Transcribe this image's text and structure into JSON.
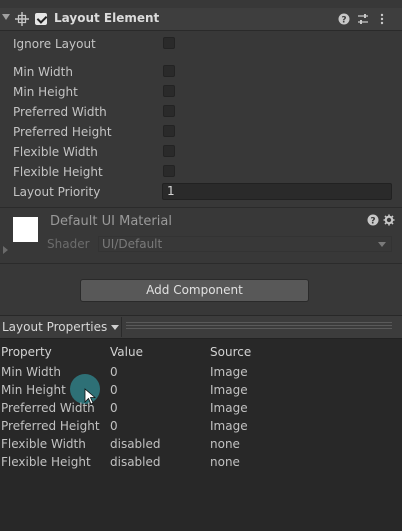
{
  "component": {
    "title": "Layout Element",
    "enabled": true,
    "fields": [
      {
        "label": "Ignore Layout"
      },
      {
        "label": "Min Width"
      },
      {
        "label": "Min Height"
      },
      {
        "label": "Preferred Width"
      },
      {
        "label": "Preferred Height"
      },
      {
        "label": "Flexible Width"
      },
      {
        "label": "Flexible Height"
      }
    ],
    "priority": {
      "label": "Layout Priority",
      "value": "1"
    }
  },
  "material": {
    "name": "Default UI Material",
    "shader_label": "Shader",
    "shader_value": "UI/Default"
  },
  "add_component_label": "Add Component",
  "layout_properties": {
    "title": "Layout Properties",
    "headers": [
      "Property",
      "Value",
      "Source"
    ],
    "rows": [
      [
        "Min Width",
        "0",
        "Image"
      ],
      [
        "Min Height",
        "0",
        "Image"
      ],
      [
        "Preferred Width",
        "0",
        "Image"
      ],
      [
        "Preferred Height",
        "0",
        "Image"
      ],
      [
        "Flexible Width",
        "disabled",
        "none"
      ],
      [
        "Flexible Height",
        "disabled",
        "none"
      ]
    ]
  },
  "colors": {
    "background": "#383838",
    "panel": "#282828",
    "cursor": "#2f7c84"
  }
}
